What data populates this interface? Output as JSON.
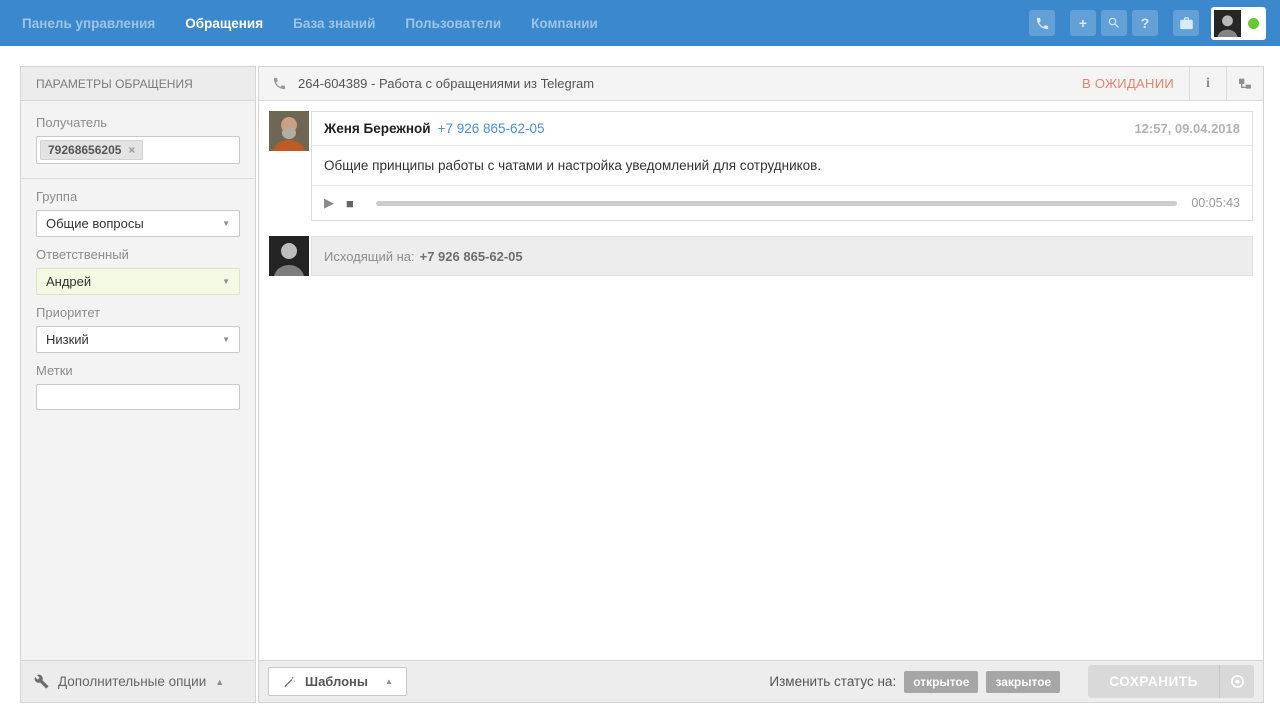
{
  "topbar": {
    "nav": [
      {
        "label": "Панель управления",
        "active": false
      },
      {
        "label": "Обращения",
        "active": true
      },
      {
        "label": "База знаний",
        "active": false
      },
      {
        "label": "Пользователи",
        "active": false
      },
      {
        "label": "Компании",
        "active": false
      }
    ],
    "icons": [
      "phone-icon",
      "plus-icon",
      "search-icon",
      "help-icon",
      "briefcase-icon"
    ],
    "colors": {
      "bar": "#3b89cc",
      "online_dot": "#67c832"
    }
  },
  "sidebar": {
    "title": "ПАРАМЕТРЫ ОБРАЩЕНИЯ",
    "recipient": {
      "label": "Получатель",
      "tag": "79268656205"
    },
    "group": {
      "label": "Группа",
      "value": "Общие вопросы"
    },
    "assignee": {
      "label": "Ответственный",
      "value": "Андрей",
      "highlight_color": "#f3f9e3"
    },
    "priority": {
      "label": "Приоритет",
      "value": "Низкий"
    },
    "tags": {
      "label": "Метки",
      "value": ""
    },
    "footer_label": "Дополнительные опции"
  },
  "ticket": {
    "title": "264-604389 - Работа с обращениями из Telegram",
    "status": "В ОЖИДАНИИ",
    "status_color": "#e8836b",
    "messages": [
      {
        "author": "Женя Бережной",
        "phone": "+7 926 865-62-05",
        "timestamp": "12:57, 09.04.2018",
        "text": "Общие принципы работы с чатами и настройка уведомлений для сотрудников.",
        "audio_duration": "00:05:43"
      },
      {
        "label": "Исходящий на:",
        "phone": "+7 926 865-62-05"
      }
    ]
  },
  "footer": {
    "templates_label": "Шаблоны",
    "change_status_label": "Изменить статус на:",
    "status_open": "открытое",
    "status_closed": "закрытое",
    "save_label": "СОХРАНИТЬ"
  },
  "glyphs": {
    "caret_down": "▼",
    "caret_up": "▲",
    "play": "▶",
    "stop": "■",
    "plus": "+",
    "question": "?",
    "info": "i",
    "close": "×"
  }
}
